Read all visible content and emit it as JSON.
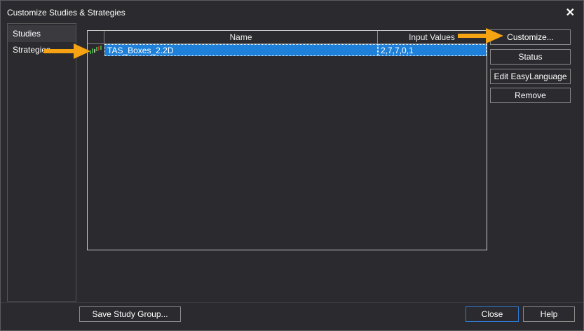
{
  "window": {
    "title": "Customize Studies & Strategies"
  },
  "sidebar": {
    "items": [
      {
        "label": "Studies",
        "selected": true
      },
      {
        "label": "Strategies",
        "selected": false
      }
    ]
  },
  "grid": {
    "columns": [
      "Name",
      "Input Values"
    ],
    "rows": [
      {
        "name": "TAS_Boxes_2.2D",
        "inputs": "2,7,7,0,1",
        "selected": true,
        "icon": "study-chart-icon"
      }
    ]
  },
  "buttons": {
    "customize": "Customize...",
    "status": "Status",
    "edit_easylanguage": "Edit EasyLanguage",
    "remove": "Remove",
    "save_study_group": "Save Study Group...",
    "close": "Close",
    "help": "Help"
  },
  "annotations": {
    "arrow_color": "#f5a312"
  }
}
